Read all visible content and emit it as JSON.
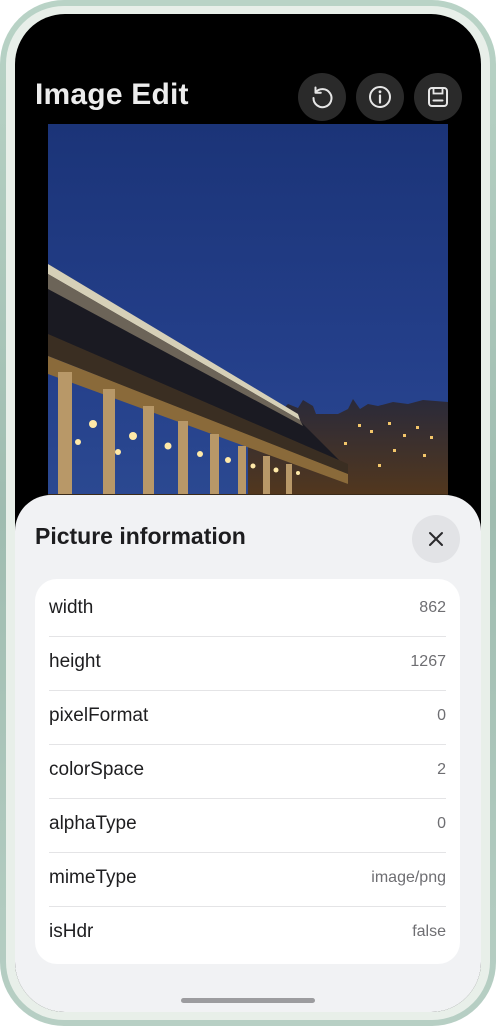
{
  "header": {
    "title": "Image Edit",
    "actions": [
      {
        "icon": "reset-icon"
      },
      {
        "icon": "info-icon"
      },
      {
        "icon": "save-icon"
      }
    ]
  },
  "photo": {
    "subject": "night-bridge-photo"
  },
  "info_panel": {
    "title": "Picture information",
    "close_icon": "close-icon",
    "rows": [
      {
        "label": "width",
        "value": "862"
      },
      {
        "label": "height",
        "value": "1267"
      },
      {
        "label": "pixelFormat",
        "value": "0"
      },
      {
        "label": "colorSpace",
        "value": "2"
      },
      {
        "label": "alphaType",
        "value": "0"
      },
      {
        "label": "mimeType",
        "value": "image/png"
      },
      {
        "label": "isHdr",
        "value": "false"
      }
    ]
  },
  "colors": {
    "sky": "#1f3b80",
    "sheet": "#f1f2f4",
    "card": "#ffffff"
  }
}
